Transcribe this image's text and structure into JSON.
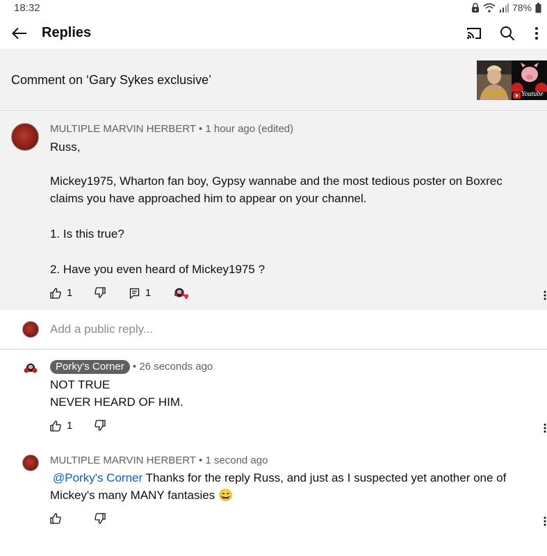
{
  "status_bar": {
    "time": "18:32",
    "battery": "78%",
    "icons": [
      "lock-icon",
      "wifi-icon",
      "signal-icon",
      "battery-icon"
    ]
  },
  "app_bar": {
    "title": "Replies",
    "icons": [
      "back-arrow-icon",
      "cast-icon",
      "search-icon",
      "more-vert-icon"
    ]
  },
  "context": {
    "label": "Comment on ‘Gary Sykes exclusive’",
    "thumbnail_text": "Youtube"
  },
  "parent_comment": {
    "author": "MULTIPLE MARVIN HERBERT",
    "separator": "•",
    "time": "1 hour ago (edited)",
    "lines": [
      "Russ,",
      "Mickey1975, Wharton fan boy, Gypsy wannabe and the most tedious poster on Boxrec",
      "claims you have approached him to appear on your channel.",
      "1. Is this true?",
      "2. Have you even heard of Mickey1975 ?"
    ],
    "likes": "1",
    "replies": "1"
  },
  "reply_input": {
    "placeholder": "Add a public reply..."
  },
  "replies": [
    {
      "author": "Porky's Corner",
      "time": "26 seconds ago",
      "lines": [
        "NOT TRUE",
        "NEVER HEARD OF HIM."
      ],
      "likes": "1"
    },
    {
      "author": "MULTIPLE MARVIN HERBERT",
      "time": "1 second ago",
      "mention": "@Porky's Corner",
      "line1": " Thanks for the reply Russ, and just as I suspected yet another one of",
      "line2": "Mickey's many MANY fantasies",
      "emoji": "😄"
    }
  ],
  "colors": {
    "accent_link": "#065fd4",
    "highlight_bg": "#f2f2f2",
    "meta_text": "#606060",
    "heart": "#e3262f"
  }
}
